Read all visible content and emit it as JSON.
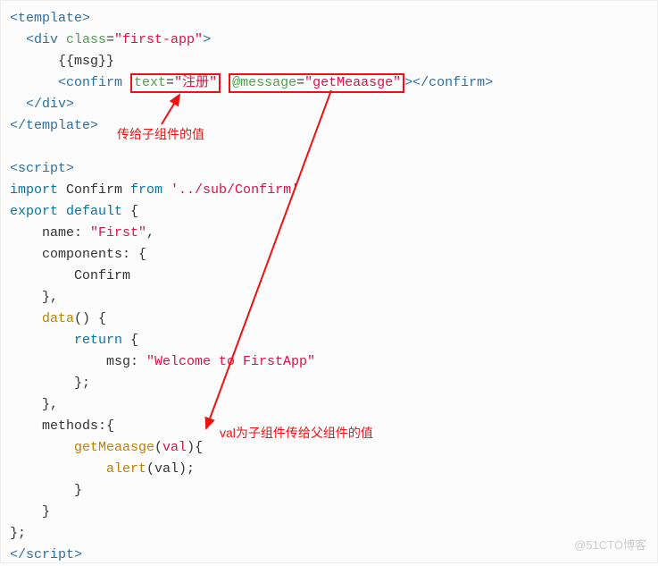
{
  "code": {
    "l1a": "<template>",
    "l2a": "  <div ",
    "l2b": "class",
    "l2c": "=",
    "l2d": "\"first-app\"",
    "l2e": ">",
    "l3a": "      {{msg}}",
    "l4a": "      <confirm ",
    "l4b_attr": "text",
    "l4b_eq": "=",
    "l4b_val": "\"注册\"",
    "l4c_sp": " ",
    "l4d_at": "@message",
    "l4d_eq": "=",
    "l4d_val": "\"getMeaasge\"",
    "l4e": "></confirm>",
    "l5a": "  </div>",
    "l6a": "</template>",
    "blank1": " ",
    "l8a": "<script>",
    "l9a": "import",
    "l9b": " Confirm ",
    "l9c": "from",
    "l9d": " '../sub/Confirm'",
    "l10a": "export",
    "l10b": " ",
    "l10c": "default",
    "l10d": " {",
    "l11a": "    name: ",
    "l11b": "\"First\"",
    "l11c": ",",
    "l12a": "    components: {",
    "l13a": "        Confirm",
    "l14a": "    },",
    "l15a": "    ",
    "l15b": "data",
    "l15c": "() {",
    "l16a": "        ",
    "l16b": "return",
    "l16c": " {",
    "l17a": "            msg: ",
    "l17b": "\"Welcome to FirstApp\"",
    "l18a": "        };",
    "l19a": "    },",
    "l20a": "    methods:{",
    "l21a": "        ",
    "l21b": "getMeaasge",
    "l21c": "(",
    "l21d": "val",
    "l21e": "){",
    "l22a": "            ",
    "l22b": "alert",
    "l22c": "(val);",
    "l23a": "        }",
    "l24a": "    }",
    "l25a": "};",
    "l26a": "</",
    "l26b": "script",
    "l26c": ">"
  },
  "annotations": {
    "anno1": "传给子组件的值",
    "anno2": "val为子组件传给父组件的值"
  },
  "watermark": "@51CTO博客"
}
